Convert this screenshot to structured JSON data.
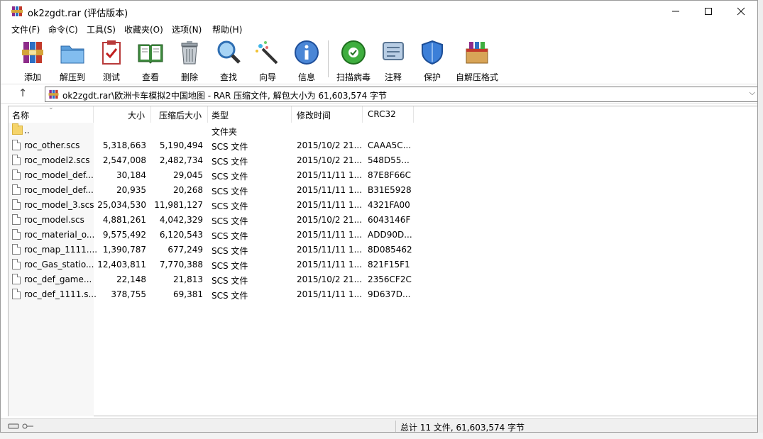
{
  "window": {
    "title": "ok2zgdt.rar (评估版本)"
  },
  "menu": [
    "文件(F)",
    "命令(C)",
    "工具(S)",
    "收藏夹(O)",
    "选项(N)",
    "帮助(H)"
  ],
  "toolbar": [
    {
      "label": "添加",
      "icon": "add-archive-icon"
    },
    {
      "label": "解压到",
      "icon": "extract-to-icon"
    },
    {
      "label": "测试",
      "icon": "test-icon"
    },
    {
      "label": "查看",
      "icon": "view-icon"
    },
    {
      "label": "删除",
      "icon": "delete-icon"
    },
    {
      "label": "查找",
      "icon": "find-icon"
    },
    {
      "label": "向导",
      "icon": "wizard-icon"
    },
    {
      "label": "信息",
      "icon": "info-icon"
    },
    {
      "label": "扫描病毒",
      "icon": "scan-virus-icon"
    },
    {
      "label": "注释",
      "icon": "comment-icon"
    },
    {
      "label": "保护",
      "icon": "protect-icon"
    },
    {
      "label": "自解压格式",
      "icon": "sfx-icon"
    }
  ],
  "address": {
    "path": "ok2zgdt.rar\\欧洲卡车模拟2中国地图 - RAR 压缩文件, 解包大小为 61,603,574 字节"
  },
  "columns": {
    "name": "名称",
    "size": "大小",
    "packed": "压缩后大小",
    "type": "类型",
    "modified": "修改时间",
    "crc": "CRC32"
  },
  "files": [
    {
      "name": "..",
      "size": "",
      "packed": "",
      "type": "文件夹",
      "modified": "",
      "crc": "",
      "icon": "folder"
    },
    {
      "name": "roc_other.scs",
      "size": "5,318,663",
      "packed": "5,190,494",
      "type": "SCS 文件",
      "modified": "2015/10/2 21...",
      "crc": "CAAA5C...",
      "icon": "file"
    },
    {
      "name": "roc_model2.scs",
      "size": "2,547,008",
      "packed": "2,482,734",
      "type": "SCS 文件",
      "modified": "2015/10/2 21...",
      "crc": "548D55...",
      "icon": "file"
    },
    {
      "name": "roc_model_def...",
      "size": "30,184",
      "packed": "29,045",
      "type": "SCS 文件",
      "modified": "2015/11/11 1...",
      "crc": "87E8F66C",
      "icon": "file"
    },
    {
      "name": "roc_model_def...",
      "size": "20,935",
      "packed": "20,268",
      "type": "SCS 文件",
      "modified": "2015/11/11 1...",
      "crc": "B31E5928",
      "icon": "file"
    },
    {
      "name": "roc_model_3.scs",
      "size": "25,034,530",
      "packed": "11,981,127",
      "type": "SCS 文件",
      "modified": "2015/11/11 1...",
      "crc": "4321FA00",
      "icon": "file"
    },
    {
      "name": "roc_model.scs",
      "size": "4,881,261",
      "packed": "4,042,329",
      "type": "SCS 文件",
      "modified": "2015/10/2 21...",
      "crc": "6043146F",
      "icon": "file"
    },
    {
      "name": "roc_material_o...",
      "size": "9,575,492",
      "packed": "6,120,543",
      "type": "SCS 文件",
      "modified": "2015/11/11 1...",
      "crc": "ADD90D...",
      "icon": "file"
    },
    {
      "name": "roc_map_1111....",
      "size": "1,390,787",
      "packed": "677,249",
      "type": "SCS 文件",
      "modified": "2015/11/11 1...",
      "crc": "8D085462",
      "icon": "file"
    },
    {
      "name": "roc_Gas_statio...",
      "size": "12,403,811",
      "packed": "7,770,388",
      "type": "SCS 文件",
      "modified": "2015/11/11 1...",
      "crc": "821F15F1",
      "icon": "file"
    },
    {
      "name": "roc_def_game...",
      "size": "22,148",
      "packed": "21,813",
      "type": "SCS 文件",
      "modified": "2015/10/2 21...",
      "crc": "2356CF2C",
      "icon": "file"
    },
    {
      "name": "roc_def_1111.s...",
      "size": "378,755",
      "packed": "69,381",
      "type": "SCS 文件",
      "modified": "2015/11/11 1...",
      "crc": "9D637D...",
      "icon": "file"
    }
  ],
  "status": {
    "summary": "总计 11 文件, 61,603,574 字节"
  }
}
